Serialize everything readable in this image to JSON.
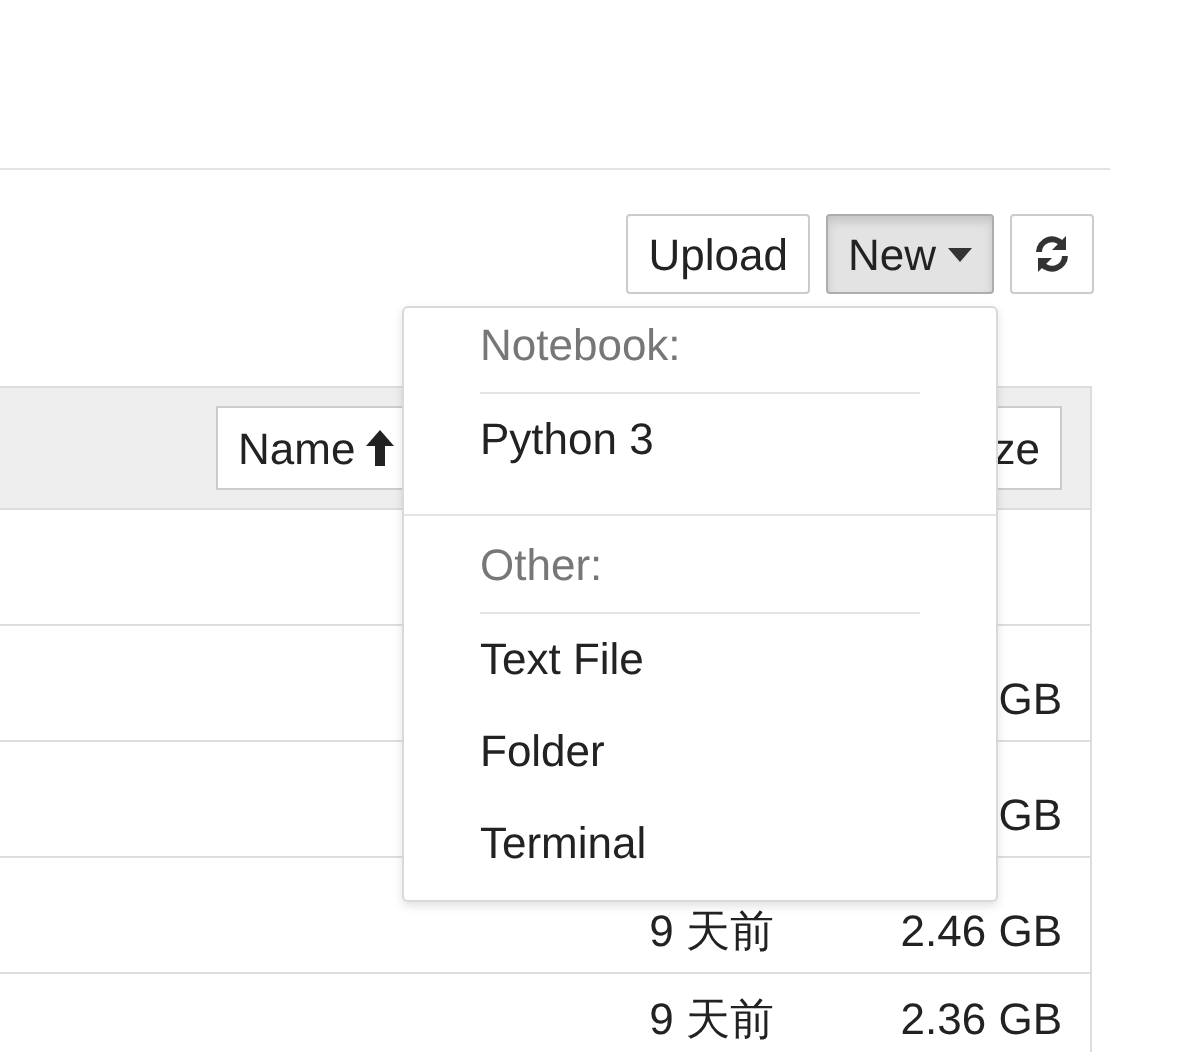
{
  "toolbar": {
    "buttons": [
      {
        "kind": "text",
        "label": "Upload",
        "active": false
      },
      {
        "kind": "dropdown",
        "label": "New",
        "active": true
      },
      {
        "kind": "refresh",
        "active": false
      }
    ]
  },
  "table": {
    "header_buttons": [
      {
        "label": "Name",
        "sorted": true
      },
      {
        "label": "ze"
      }
    ],
    "rows": [
      {},
      {
        "size": "GB"
      },
      {
        "size": "GB"
      },
      {
        "modified": "9 天前",
        "size": "2.46 GB"
      },
      {
        "modified": "9 天前",
        "size": "2.36 GB"
      }
    ]
  },
  "menu": {
    "open": true,
    "sections": [
      {
        "header": "Notebook:",
        "items": [
          "Python 3"
        ]
      },
      {
        "header": "Other:",
        "items": [
          "Text File",
          "Folder",
          "Terminal"
        ]
      }
    ]
  }
}
